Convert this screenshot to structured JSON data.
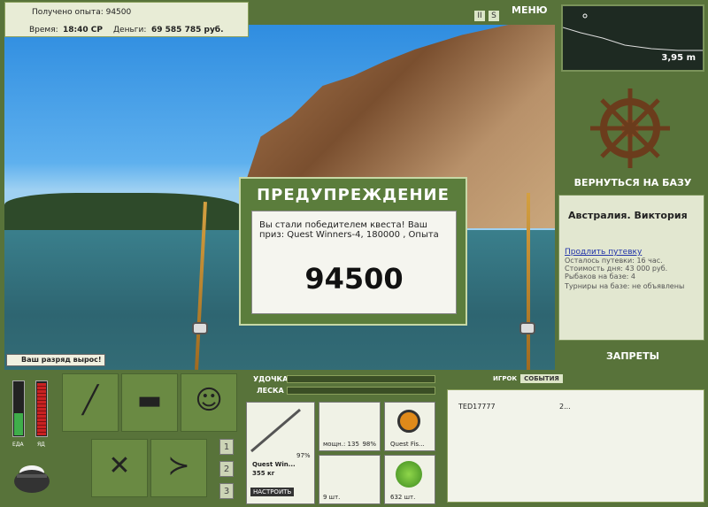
{
  "info": {
    "xp_label": "Получено опыта: 94500",
    "time_label": "Время:",
    "time_value": "18:40 СР",
    "money_label": "Деньги:",
    "money_value": "69 585 785 руб."
  },
  "top_icons": [
    "II",
    "S"
  ],
  "menu_label": "МЕНЮ",
  "depth": {
    "value": "3,95 m"
  },
  "right": {
    "return_base": "ВЕРНУТЬСЯ НА БАЗУ",
    "base_name": "Австралия. Виктория",
    "extend_link": "Продлить путевку",
    "remaining": "Осталось путевки: 16 час.",
    "cost": "Стоимость дня: 43 000 руб.",
    "anglers": "Рыбаков на базе: 4",
    "tournaments": "Турниры на базе: не объявлены",
    "bans": "ЗАПРЕТЫ"
  },
  "dialog": {
    "title": "ПРЕДУПРЕЖДЕНИЕ",
    "message": "Вы стали победителем квеста! Ваш приз: Quest Winners-4, 180000 , Опыта",
    "value": "94500"
  },
  "rank_toast": "Ваш разряд вырос!",
  "meters": {
    "food_label": "ЕДА",
    "poison_label": "ЯД",
    "food_level": 0.4,
    "poison_level": 0.95
  },
  "pages": [
    "1",
    "2",
    "3"
  ],
  "tackle": {
    "rod_label": "УДОЧКА",
    "line_label": "ЛЕСКА",
    "rod_name": "Quest Win...",
    "rod_weight": "355 кг",
    "rod_pct": "97%",
    "reel_power": "мощн.: 135",
    "reel_pct": "98%",
    "line_name": "Quest Fis...",
    "hooks": "9 шт.",
    "bait": "632 шт.",
    "setup_btn": "НАСТРОИТЬ"
  },
  "chat": {
    "tab_player": "ИГРОК",
    "tab_events": "СОБЫТИЯ",
    "rows": [
      {
        "name": "TED17777",
        "value": "2..."
      }
    ]
  },
  "colors": {
    "panel": "#58733a",
    "accent": "#c7d8a6"
  }
}
